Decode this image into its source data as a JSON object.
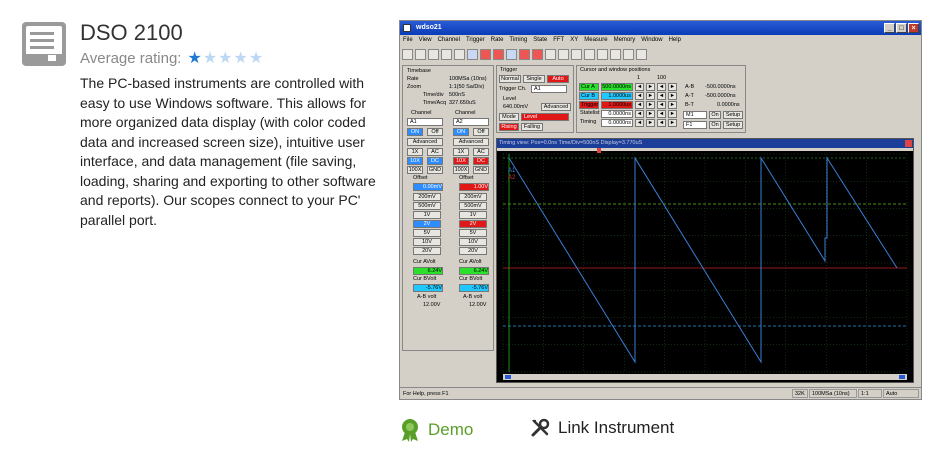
{
  "product": {
    "title": "DSO 2100",
    "rating_label": "Average rating:",
    "rating": 1,
    "rating_max": 5,
    "description": "The PC-based instruments are controlled with easy to use Windows software. This allows for more organized data display (with color coded data and increased screen size), intuitive user interface, and data management (file saving, loading, sharing and exporting to other software and reports). Our scopes connect to your PC' parallel port."
  },
  "screenshot": {
    "window_title": "wdso21",
    "menu": [
      "File",
      "View",
      "Channel",
      "Trigger",
      "Rate",
      "Timing",
      "State",
      "FFT",
      "XY",
      "Measure",
      "Memory",
      "Window",
      "Help"
    ],
    "timebase": {
      "header": "Timebase",
      "rate_label": "Rate",
      "rate_value": "100MSa (10ns)",
      "zoom_label": "Zoom",
      "zoom_value": "1:1(50 Sa/Div)",
      "timediv_label": "Time/div",
      "timediv_value": "500nS",
      "timeacq_label": "Time/Acq",
      "timeacq_value": "327.650uS"
    },
    "channel_header": "Channel",
    "ch_a": {
      "select": "A1",
      "on": "ON",
      "off": "Off",
      "advanced": "Advanced",
      "x1": "1X",
      "ac": "AC",
      "x10": "10X",
      "dc": "DC",
      "x100": "100X",
      "gnd": "GND",
      "offset_label": "Offset",
      "offset_value": "0.00mV",
      "volts": [
        "200mV",
        "500mV",
        "1V",
        "2V",
        "5V",
        "10V",
        "20V"
      ],
      "cur_a_label": "Cur AVolt",
      "cur_a_value": "6.24V",
      "cur_b_label": "Cur BVolt",
      "cur_b_value": "-5.76V",
      "ab_label": "A-B volt",
      "ab_value": "12.00V"
    },
    "ch_b": {
      "select": "A2",
      "on": "ON",
      "off": "Off",
      "advanced": "Advanced",
      "x1": "1X",
      "ac": "AC",
      "x10": "10X",
      "dc": "DC",
      "x100": "100X",
      "gnd": "GND",
      "offset_label": "Offset",
      "offset_value": "1.00V",
      "volts": [
        "200mV",
        "500mV",
        "1V",
        "2V",
        "5V",
        "10V",
        "20V"
      ],
      "cur_a_label": "Cur AVolt",
      "cur_a_value": "6.24V",
      "cur_b_label": "Cur BVolt",
      "cur_b_value": "-5.76V",
      "ab_label": "A-B volt",
      "ab_value": "12.00V"
    },
    "trigger": {
      "header": "Trigger",
      "normal": "Normal",
      "single": "Single",
      "auto": "Auto",
      "ch_label": "Trigger Ch.",
      "ch_value": "A1",
      "level_label": "Level",
      "level_value": "640.00mV",
      "advanced": "Advanced",
      "mode": "Mode",
      "level": "Level",
      "rising": "Rising",
      "falling": "Falling"
    },
    "cursor": {
      "header": "Cursor and window positions",
      "col1": "1",
      "col2": "100",
      "rows": [
        {
          "label": "Cur A",
          "value": "500.0000ns"
        },
        {
          "label": "Cur B",
          "value": "1.0000us"
        },
        {
          "label": "Trigger",
          "value": "1.0000us"
        },
        {
          "label": "Statelist",
          "value": "0.0000ns"
        },
        {
          "label": "Timing",
          "value": "0.0000ns"
        }
      ],
      "ab_label": "A-B",
      "ab_value": "-500.0000ns",
      "at_label": "A-T",
      "at_value": "-500.0000ns",
      "bt_label": "B-T",
      "bt_value": "0.0000ns",
      "m1": "M1",
      "f1": "F1",
      "on": "On",
      "setup": "Setup"
    },
    "scope": {
      "title": "Timing view: Pos=0.0ns Time/Div=500nS Display=3.770uS",
      "label_a1": "A1",
      "label_a2": "A2"
    },
    "status": {
      "help": "For Help, press F1",
      "mem": "32K",
      "rate": "100MSa (10ns)",
      "zoom": "1:1",
      "mode": "Auto"
    }
  },
  "actions": {
    "demo": "Demo",
    "link": "Link Instrument"
  }
}
